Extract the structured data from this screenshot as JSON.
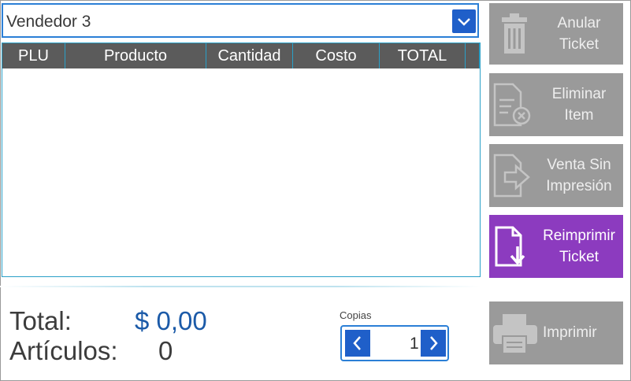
{
  "vendor": {
    "selected": "Vendedor 3"
  },
  "table": {
    "columns": [
      "PLU",
      "Producto",
      "Cantidad",
      "Costo",
      "TOTAL"
    ]
  },
  "totals": {
    "total_label": "Total:",
    "total_value": "$ 0,00",
    "items_label": "Artículos:",
    "items_value": "0"
  },
  "copies": {
    "label": "Copias",
    "value": "1"
  },
  "actions": {
    "void_ticket": [
      "Anular",
      "Ticket"
    ],
    "delete_item": [
      "Eliminar",
      "Item"
    ],
    "sale_no_print": [
      "Venta Sin",
      "Impresión"
    ],
    "reprint_ticket": [
      "Reimprimir",
      "Ticket"
    ],
    "print": "Imprimir"
  },
  "colors": {
    "accent_blue": "#1f5fc9",
    "active_purple": "#8c3bbf",
    "disabled_gray": "#9a9a9a",
    "header_gray": "#5b5b5b",
    "amount_blue": "#1b5aa8"
  }
}
